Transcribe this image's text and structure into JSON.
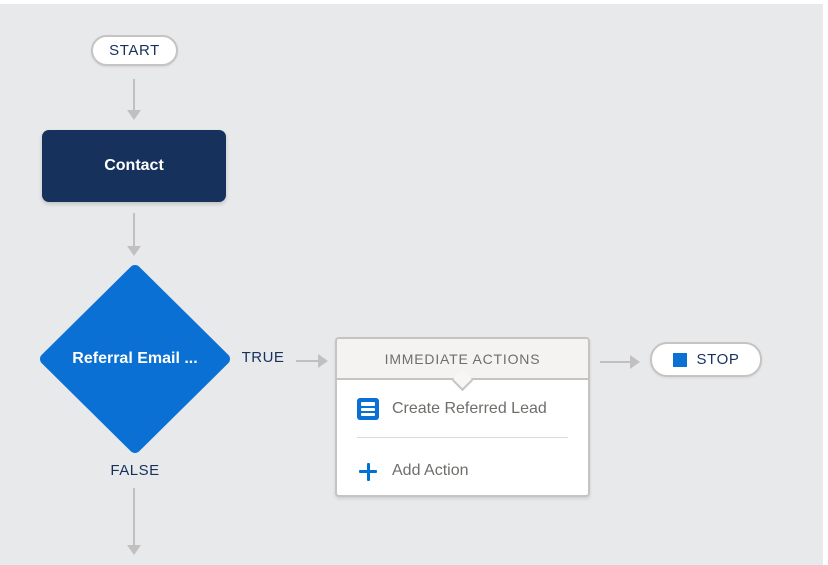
{
  "flow": {
    "start_label": "START",
    "stop_label": "STOP",
    "object_node": {
      "label": "Contact"
    },
    "criteria_node": {
      "label": "Referral Email ...",
      "true_label": "TRUE",
      "false_label": "FALSE"
    },
    "actions_panel": {
      "header": "IMMEDIATE ACTIONS",
      "items": [
        {
          "icon": "record-create-icon",
          "label": "Create Referred Lead"
        },
        {
          "icon": "plus-icon",
          "label": "Add Action"
        }
      ]
    }
  },
  "colors": {
    "canvas_background": "#e8e9eb",
    "navy": "#16325c",
    "criteria_blue": "#0b70d4",
    "action_icon_blue": "#0b70d4",
    "plus_blue": "#0070d2",
    "arrow_gray": "#c2c0bf",
    "border_gray": "#c6c4c2",
    "muted_text": "#706e6b"
  }
}
